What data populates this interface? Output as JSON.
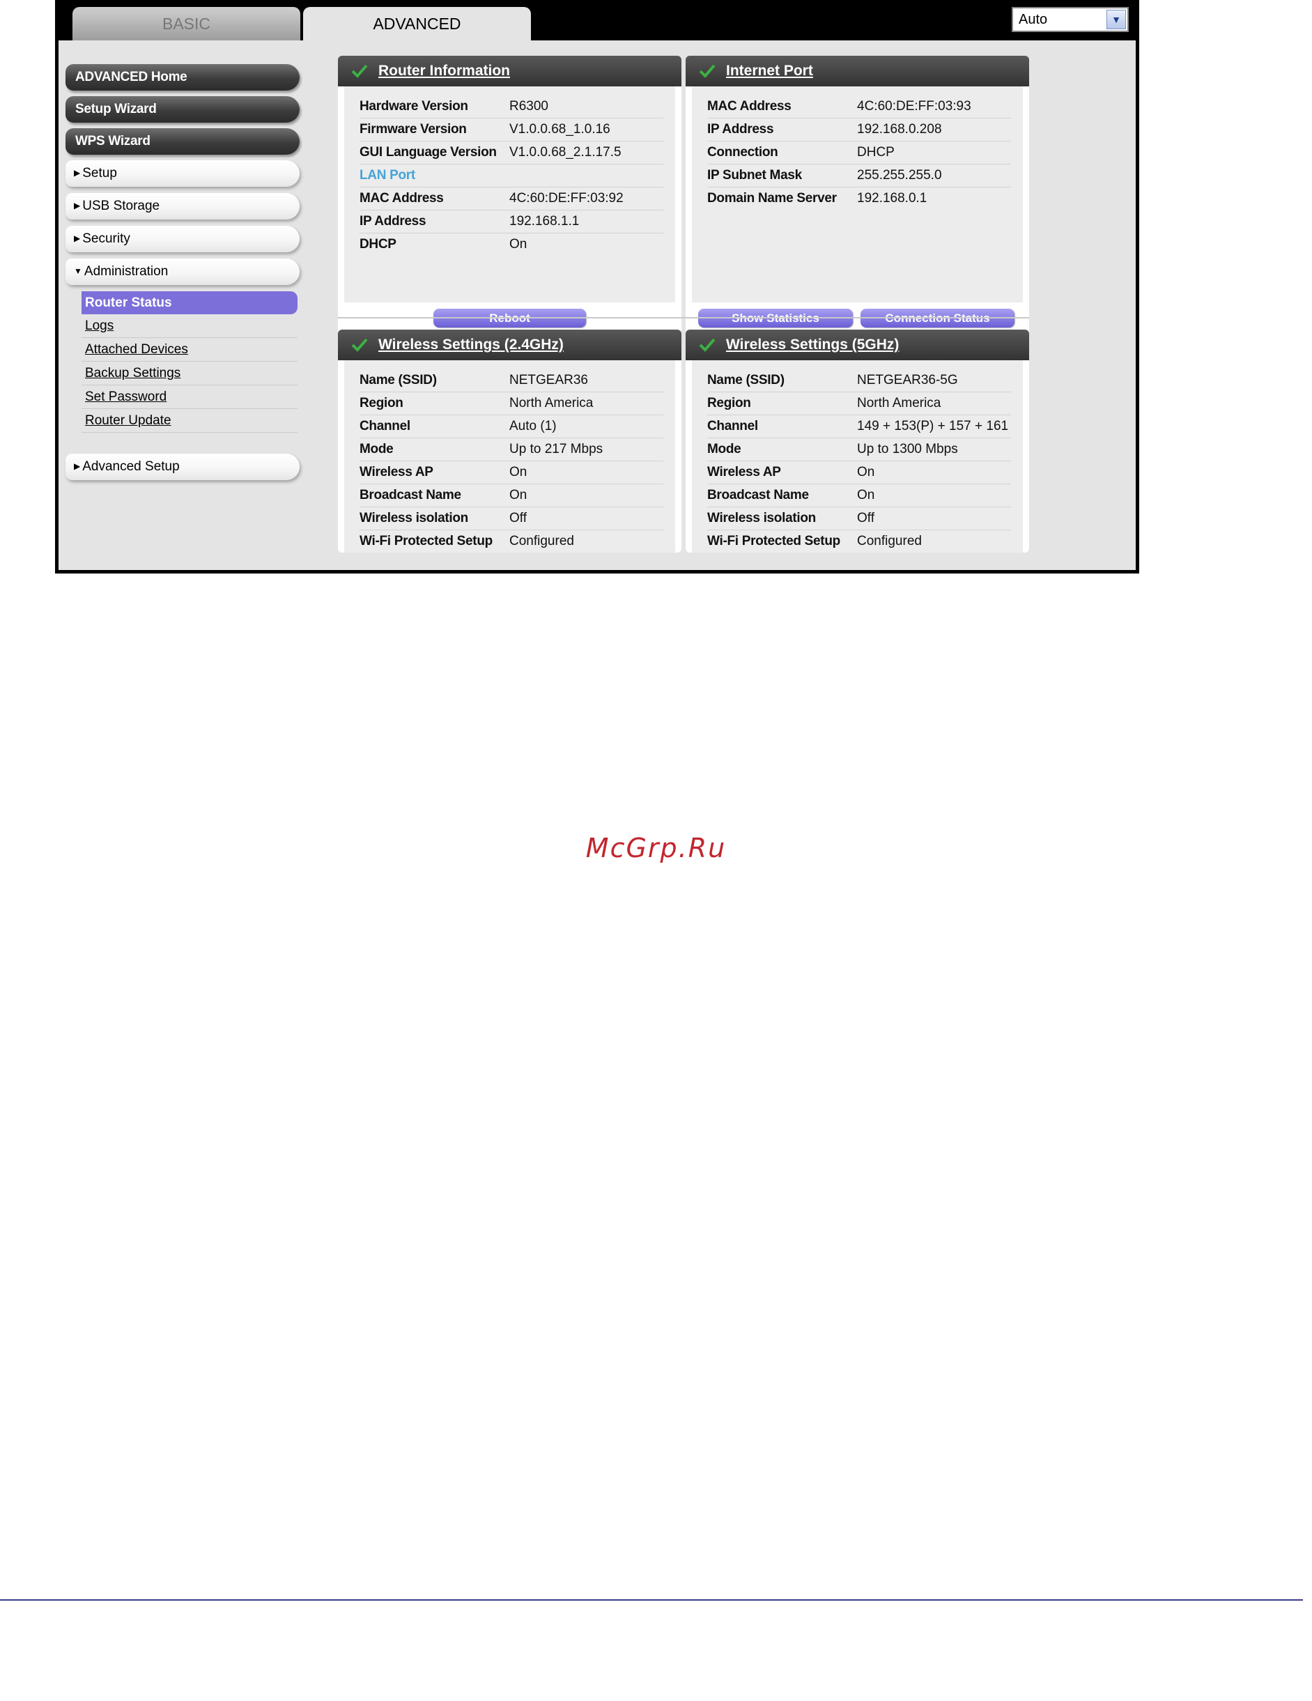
{
  "tabs": {
    "basic": "BASIC",
    "advanced": "ADVANCED"
  },
  "language_select": {
    "value": "Auto"
  },
  "sidebar": {
    "buttons": [
      "ADVANCED Home",
      "Setup Wizard",
      "WPS Wizard"
    ],
    "sections": [
      "Setup",
      "USB Storage",
      "Security",
      "Administration"
    ],
    "administration_items": [
      "Router Status",
      "Logs",
      "Attached Devices",
      "Backup Settings",
      "Set Password",
      "Router Update"
    ],
    "advanced_setup": "Advanced Setup"
  },
  "router_info": {
    "title": "Router Information",
    "rows": [
      {
        "k": "Hardware Version",
        "v": "R6300"
      },
      {
        "k": "Firmware Version",
        "v": "V1.0.0.68_1.0.16"
      },
      {
        "k": "GUI Language Version",
        "v": "V1.0.0.68_2.1.17.5"
      },
      {
        "k": "LAN Port",
        "v": ""
      },
      {
        "k": "MAC Address",
        "v": "4C:60:DE:FF:03:92"
      },
      {
        "k": "IP Address",
        "v": "192.168.1.1"
      },
      {
        "k": "DHCP",
        "v": "On"
      }
    ],
    "button": "Reboot"
  },
  "internet_port": {
    "title": "Internet Port",
    "rows": [
      {
        "k": "MAC Address",
        "v": "4C:60:DE:FF:03:93"
      },
      {
        "k": "IP Address",
        "v": "192.168.0.208"
      },
      {
        "k": "Connection",
        "v": "DHCP"
      },
      {
        "k": "IP Subnet Mask",
        "v": "255.255.255.0"
      },
      {
        "k": "Domain Name Server",
        "v": "192.168.0.1"
      }
    ],
    "buttons": [
      "Show Statistics",
      "Connection Status"
    ]
  },
  "wireless_24": {
    "title": "Wireless Settings (2.4GHz)",
    "rows": [
      {
        "k": "Name (SSID)",
        "v": "NETGEAR36"
      },
      {
        "k": "Region",
        "v": "North America"
      },
      {
        "k": "Channel",
        "v": "Auto (1)"
      },
      {
        "k": "Mode",
        "v": "Up to 217 Mbps"
      },
      {
        "k": "Wireless AP",
        "v": "On"
      },
      {
        "k": "Broadcast Name",
        "v": "On"
      },
      {
        "k": "Wireless isolation",
        "v": "Off"
      },
      {
        "k": "Wi-Fi Protected Setup",
        "v": "Configured"
      }
    ]
  },
  "wireless_5": {
    "title": "Wireless Settings (5GHz)",
    "rows": [
      {
        "k": "Name (SSID)",
        "v": "NETGEAR36-5G"
      },
      {
        "k": "Region",
        "v": "North America"
      },
      {
        "k": "Channel",
        "v": "149 + 153(P) + 157 + 161"
      },
      {
        "k": "Mode",
        "v": "Up to 1300 Mbps"
      },
      {
        "k": "Wireless AP",
        "v": "On"
      },
      {
        "k": "Broadcast Name",
        "v": "On"
      },
      {
        "k": "Wireless isolation",
        "v": "Off"
      },
      {
        "k": "Wi-Fi Protected Setup",
        "v": "Configured"
      }
    ]
  },
  "colors": {
    "accent": "#7c6fd9",
    "header": "#3f3f3f",
    "check": "#3cb043",
    "watermark": "#c2262e"
  },
  "watermark": "McGrp.Ru"
}
